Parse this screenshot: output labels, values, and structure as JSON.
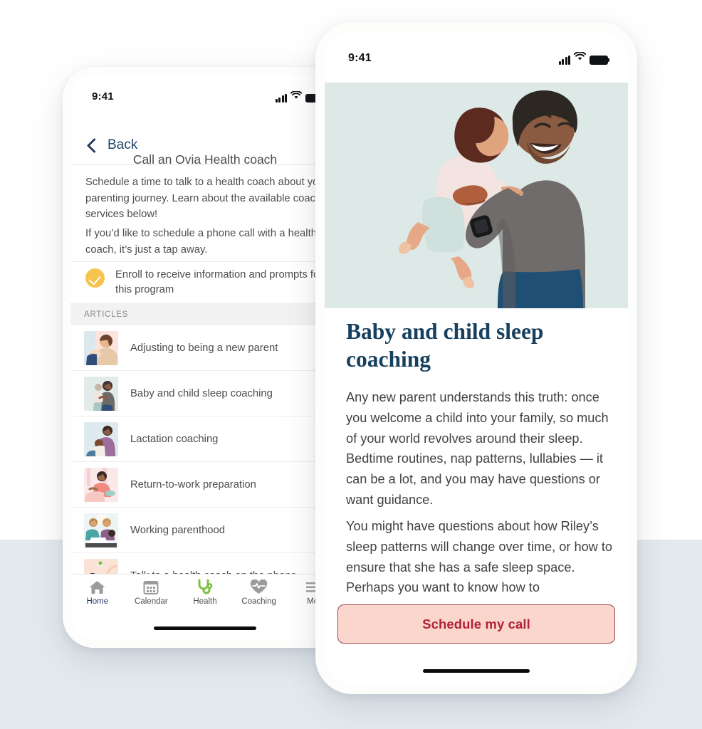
{
  "page": {
    "background_top": "#ffffff",
    "background_bottom": "#e4e9ee"
  },
  "left_phone": {
    "status": {
      "time": "9:41"
    },
    "nav": {
      "back_label": "Back"
    },
    "title": "Call an Ovia Health coach",
    "paragraph1": "Schedule a time to talk to a health coach about your parenting journey. Learn about the available coaching services below!",
    "paragraph2": "If you’d like to schedule a phone call with a health coach, it’s just a tap away.",
    "enroll": {
      "icon": "check-circle-icon",
      "text": "Enroll to receive information and prompts for this program",
      "color": "#f5c44e"
    },
    "section_header": "ARTICLES",
    "articles": [
      {
        "label": "Adjusting to being a new parent",
        "thumb": "parent-holding-newborn-thumb"
      },
      {
        "label": "Baby and child sleep coaching",
        "thumb": "father-holding-baby-thumb"
      },
      {
        "label": "Lactation coaching",
        "thumb": "nursing-parent-thumb"
      },
      {
        "label": "Return-to-work preparation",
        "thumb": "parent-with-laptop-thumb"
      },
      {
        "label": "Working parenthood",
        "thumb": "two-parents-working-thumb"
      },
      {
        "label": "Talk to a health coach on the phone",
        "thumb": "woman-on-phone-thumb"
      }
    ],
    "tabs": [
      {
        "label": "Home",
        "icon": "home-icon",
        "active": true,
        "color": "#1e3a5f"
      },
      {
        "label": "Calendar",
        "icon": "calendar-icon",
        "active": false,
        "color": "#4e4e51"
      },
      {
        "label": "Health",
        "icon": "stethoscope-icon",
        "active": true,
        "color": "#7cc043"
      },
      {
        "label": "Coaching",
        "icon": "heart-pulse-icon",
        "active": false,
        "color": "#4e4e51"
      },
      {
        "label": "Mo",
        "icon": "menu-icon",
        "active": false,
        "color": "#4e4e51"
      }
    ]
  },
  "right_phone": {
    "status": {
      "time": "9:41"
    },
    "hero": {
      "alt": "father-holding-toddler-illustration",
      "background": "#dde9e7"
    },
    "title": "Baby and child sleep coaching",
    "body1": "Any new parent understands this truth: once you welcome a child into your family, so much of your world revolves around their sleep. Bedtime routines, nap patterns, lullabies — it can be a lot, and you may have questions or want guidance.",
    "body2": "You might have questions about how Riley’s sleep patterns will change over time, or how to ensure that she has a safe sleep space. Perhaps you want to know how to",
    "cta": {
      "label": "Schedule my call",
      "background": "#fbd6cc",
      "border_color": "#9f4250",
      "text_color": "#b12237"
    }
  }
}
